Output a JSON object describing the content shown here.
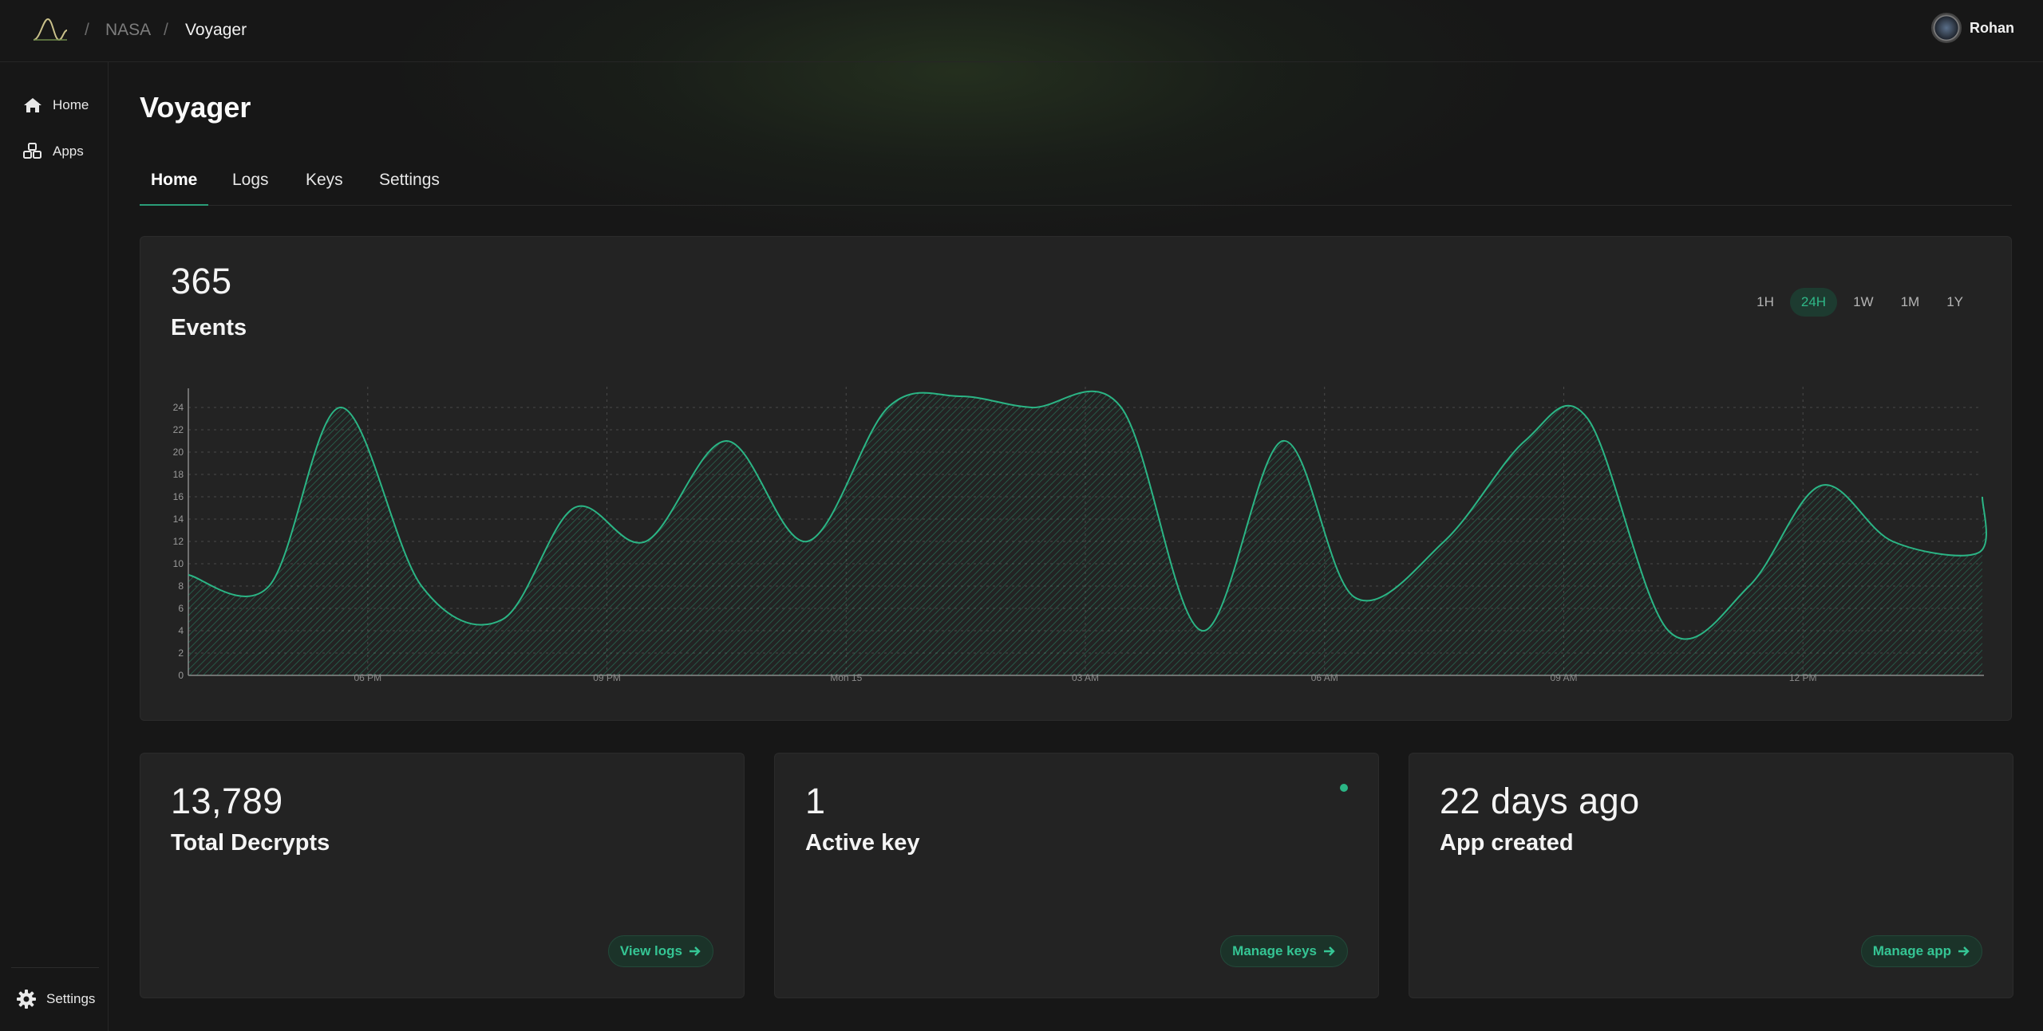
{
  "colors": {
    "accent": "#2bb585",
    "background": "#171717",
    "card": "#232323"
  },
  "breadcrumb": {
    "org": "NASA",
    "app": "Voyager",
    "separator": "/"
  },
  "user": {
    "name": "Rohan"
  },
  "sidebar": {
    "items": [
      {
        "label": "Home",
        "icon": "home-icon"
      },
      {
        "label": "Apps",
        "icon": "cubes-icon"
      }
    ],
    "settings_label": "Settings",
    "settings_icon": "gear-icon"
  },
  "page": {
    "title": "Voyager"
  },
  "tabs": [
    "Home",
    "Logs",
    "Keys",
    "Settings"
  ],
  "events_card": {
    "value": "365",
    "label": "Events",
    "ranges": [
      "1H",
      "24H",
      "1W",
      "1M",
      "1Y"
    ],
    "active_range": "24H"
  },
  "chart_data": {
    "type": "area",
    "x": [
      "",
      "06 PM",
      "",
      "09 PM",
      "",
      "Mon 15",
      "",
      "03 AM",
      "",
      "06 AM",
      "",
      "09 AM",
      "",
      "12 PM",
      ""
    ],
    "x_ticks": [
      "06 PM",
      "09 PM",
      "Mon 15",
      "03 AM",
      "06 AM",
      "09 AM",
      "12 PM"
    ],
    "y_ticks": [
      0,
      2,
      4,
      6,
      8,
      10,
      12,
      14,
      16,
      18,
      20,
      22,
      24
    ],
    "ylim": [
      0,
      25
    ],
    "points": [
      [
        0.0,
        9
      ],
      [
        0.045,
        8
      ],
      [
        0.085,
        24
      ],
      [
        0.13,
        8
      ],
      [
        0.175,
        5
      ],
      [
        0.215,
        15
      ],
      [
        0.255,
        12
      ],
      [
        0.3,
        21
      ],
      [
        0.345,
        12
      ],
      [
        0.39,
        24
      ],
      [
        0.43,
        25
      ],
      [
        0.47,
        24
      ],
      [
        0.52,
        24
      ],
      [
        0.565,
        4
      ],
      [
        0.61,
        21
      ],
      [
        0.65,
        7
      ],
      [
        0.7,
        12
      ],
      [
        0.745,
        21
      ],
      [
        0.78,
        23
      ],
      [
        0.825,
        4
      ],
      [
        0.87,
        8
      ],
      [
        0.91,
        17
      ],
      [
        0.95,
        12
      ],
      [
        0.998,
        11
      ],
      [
        1.0,
        16
      ]
    ],
    "grid": true,
    "legend": "none"
  },
  "stats": [
    {
      "value": "13,789",
      "label": "Total Decrypts",
      "link": "View logs"
    },
    {
      "value": "1",
      "label": "Active key",
      "link": "Manage keys"
    },
    {
      "value": "22 days ago",
      "label": "App created",
      "link": "Manage app"
    }
  ]
}
